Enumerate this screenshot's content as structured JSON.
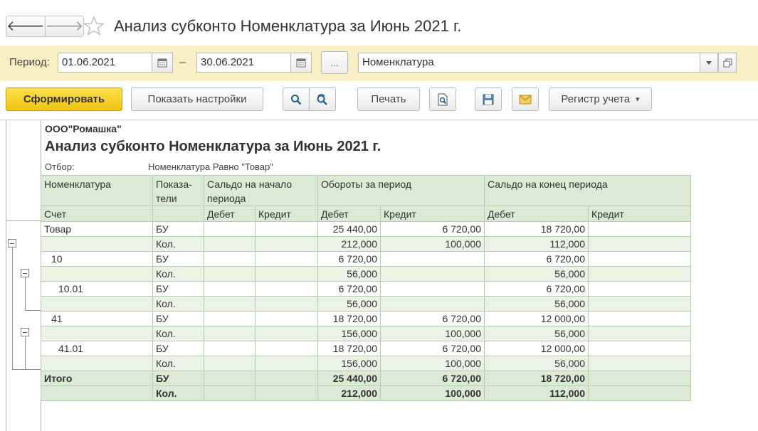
{
  "window": {
    "title": "Анализ субконто Номенклатура за Июнь 2021 г.",
    "back_glyph": "🡐",
    "forward_glyph": "🡒"
  },
  "period": {
    "label": "Период:",
    "from": "01.06.2021",
    "dash": "–",
    "to": "30.06.2021",
    "more_label": "...",
    "subconto": "Номенклатура"
  },
  "toolbar": {
    "generate": "Сформировать",
    "show_settings": "Показать настройки",
    "print": "Печать",
    "register": "Регистр учета",
    "register_arrow": "▾"
  },
  "report": {
    "org": "ООО\"Ромашка\"",
    "title": "Анализ субконто Номенклатура за Июнь 2021 г.",
    "filter_label": "Отбор:",
    "filter_value": "Номенклатура Равно \"Товар\"",
    "headers": {
      "nomenclature": "Номенклатура",
      "indicators": "Показа-\nтели",
      "opening": "Сальдо на начало периода",
      "turnover": "Обороты за период",
      "closing": "Сальдо на конец периода",
      "account": "Счет",
      "debit": "Дебет",
      "credit": "Кредит"
    },
    "rows": [
      {
        "name": "Товар",
        "ind": "БУ",
        "od": "",
        "oc": "",
        "td": "25 440,00",
        "tc": "6 720,00",
        "cd": "18 720,00",
        "cc": ""
      },
      {
        "name": "",
        "ind": "Кол.",
        "od": "",
        "oc": "",
        "td": "212,000",
        "tc": "100,000",
        "cd": "112,000",
        "cc": ""
      },
      {
        "name": "10",
        "ind": "БУ",
        "od": "",
        "oc": "",
        "td": "6 720,00",
        "tc": "",
        "cd": "6 720,00",
        "cc": ""
      },
      {
        "name": "",
        "ind": "Кол.",
        "od": "",
        "oc": "",
        "td": "56,000",
        "tc": "",
        "cd": "56,000",
        "cc": ""
      },
      {
        "name": "10.01",
        "ind": "БУ",
        "od": "",
        "oc": "",
        "td": "6 720,00",
        "tc": "",
        "cd": "6 720,00",
        "cc": ""
      },
      {
        "name": "",
        "ind": "Кол.",
        "od": "",
        "oc": "",
        "td": "56,000",
        "tc": "",
        "cd": "56,000",
        "cc": ""
      },
      {
        "name": "41",
        "ind": "БУ",
        "od": "",
        "oc": "",
        "td": "18 720,00",
        "tc": "6 720,00",
        "cd": "12 000,00",
        "cc": ""
      },
      {
        "name": "",
        "ind": "Кол.",
        "od": "",
        "oc": "",
        "td": "156,000",
        "tc": "100,000",
        "cd": "56,000",
        "cc": ""
      },
      {
        "name": "41.01",
        "ind": "БУ",
        "od": "",
        "oc": "",
        "td": "18 720,00",
        "tc": "6 720,00",
        "cd": "12 000,00",
        "cc": ""
      },
      {
        "name": "",
        "ind": "Кол.",
        "od": "",
        "oc": "",
        "td": "156,000",
        "tc": "100,000",
        "cd": "56,000",
        "cc": ""
      }
    ],
    "totals": [
      {
        "name": "Итого",
        "ind": "БУ",
        "od": "",
        "oc": "",
        "td": "25 440,00",
        "tc": "6 720,00",
        "cd": "18 720,00",
        "cc": ""
      },
      {
        "name": "",
        "ind": "Кол.",
        "od": "",
        "oc": "",
        "td": "212,000",
        "tc": "100,000",
        "cd": "112,000",
        "cc": ""
      }
    ]
  },
  "colors": {
    "period_strip": "#f9efc4",
    "primary_button": "#f1c40f",
    "table_header": "#dbe9d5",
    "table_border": "#b6ccb0"
  },
  "icons": {
    "calendar": "calendar-icon",
    "search": "search-icon",
    "search_next": "search-next-icon",
    "print_preview": "print-preview-icon",
    "save": "save-icon",
    "mail": "mail-icon",
    "favorite": "star-icon",
    "collapse": "collapse-icon",
    "dropdown": "dropdown-arrow-icon",
    "open": "open-window-icon"
  }
}
